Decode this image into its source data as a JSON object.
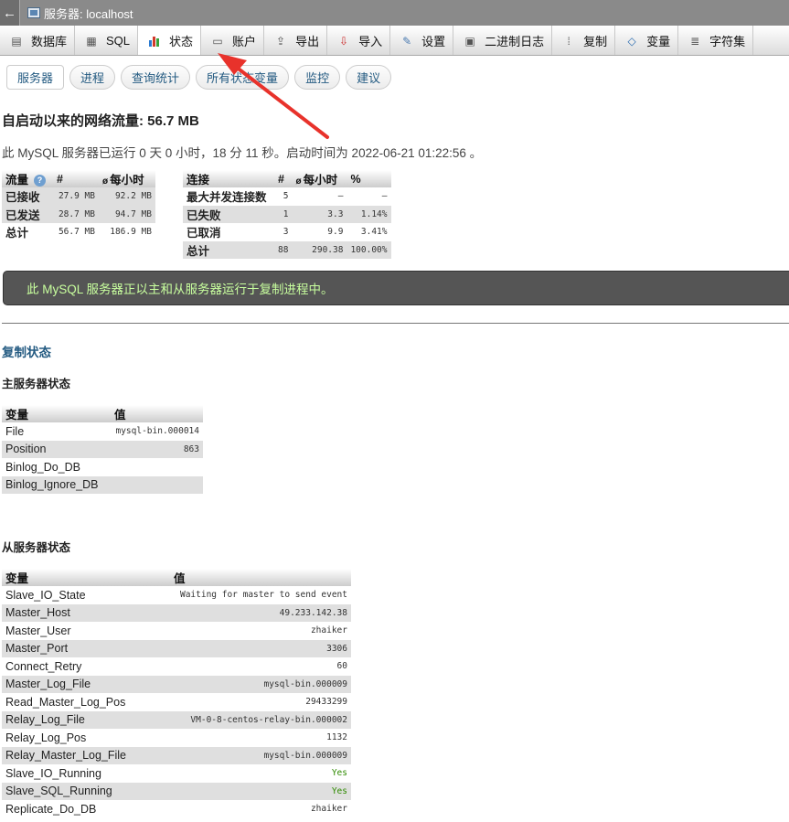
{
  "window": {
    "title": "服务器: localhost",
    "back_glyph": "←"
  },
  "menu": [
    {
      "label": "数据库",
      "icon": "database-icon",
      "glyph": "▤"
    },
    {
      "label": "SQL",
      "icon": "sql-icon",
      "glyph": "▦"
    },
    {
      "label": "状态",
      "icon": "status-chart-icon",
      "glyph": "▮"
    },
    {
      "label": "账户",
      "icon": "accounts-icon",
      "glyph": "▭"
    },
    {
      "label": "导出",
      "icon": "export-icon",
      "glyph": "⇪"
    },
    {
      "label": "导入",
      "icon": "import-icon",
      "glyph": "⇩"
    },
    {
      "label": "设置",
      "icon": "wrench-icon",
      "glyph": "✎"
    },
    {
      "label": "二进制日志",
      "icon": "binlog-icon",
      "glyph": "▣"
    },
    {
      "label": "复制",
      "icon": "replication-icon",
      "glyph": "⁞"
    },
    {
      "label": "变量",
      "icon": "variables-icon",
      "glyph": "◇"
    },
    {
      "label": "字符集",
      "icon": "charset-icon",
      "glyph": "≣"
    }
  ],
  "subtabs": [
    "服务器",
    "进程",
    "查询统计",
    "所有状态变量",
    "监控",
    "建议"
  ],
  "heading": "自启动以来的网络流量: 56.7 MB",
  "uptime": "此 MySQL 服务器已运行 0 天 0 小时，18 分 11 秒。启动时间为 2022-06-21 01:22:56 。",
  "traffic": {
    "headers": [
      "流量",
      "#",
      "每小时"
    ],
    "rows": [
      [
        "已接收",
        "27.9 MB",
        "92.2 MB"
      ],
      [
        "已发送",
        "28.7 MB",
        "94.7 MB"
      ],
      [
        "总计",
        "56.7 MB",
        "186.9 MB"
      ]
    ]
  },
  "connections": {
    "headers": [
      "连接",
      "#",
      "每小时",
      "%"
    ],
    "rows": [
      [
        "最大并发连接数",
        "5",
        "—",
        "—"
      ],
      [
        "已失败",
        "1",
        "3.3",
        "1.14%"
      ],
      [
        "已取消",
        "3",
        "9.9",
        "3.41%"
      ],
      [
        "总计",
        "88",
        "290.38",
        "100.00%"
      ]
    ]
  },
  "notice": "此 MySQL 服务器正以主和从服务器运行于复制进程中。",
  "replication": {
    "title": "复制状态",
    "master_title": "主服务器状态",
    "slave_title": "从服务器状态",
    "headers": [
      "变量",
      "值"
    ],
    "master": [
      [
        "File",
        "mysql-bin.000014"
      ],
      [
        "Position",
        "863"
      ],
      [
        "Binlog_Do_DB",
        ""
      ],
      [
        "Binlog_Ignore_DB",
        ""
      ]
    ],
    "slave": [
      [
        "Slave_IO_State",
        "Waiting for master to send event"
      ],
      [
        "Master_Host",
        "49.233.142.38"
      ],
      [
        "Master_User",
        "zhaiker"
      ],
      [
        "Master_Port",
        "3306"
      ],
      [
        "Connect_Retry",
        "60"
      ],
      [
        "Master_Log_File",
        "mysql-bin.000009"
      ],
      [
        "Read_Master_Log_Pos",
        "29433299"
      ],
      [
        "Relay_Log_File",
        "VM-0-8-centos-relay-bin.000002"
      ],
      [
        "Relay_Log_Pos",
        "1132"
      ],
      [
        "Relay_Master_Log_File",
        "mysql-bin.000009"
      ],
      [
        "Slave_IO_Running",
        "Yes"
      ],
      [
        "Slave_SQL_Running",
        "Yes"
      ],
      [
        "Replicate_Do_DB",
        "zhaiker"
      ]
    ]
  },
  "colors": {
    "accent_link": "#235a81",
    "notice_text": "#c8ff9e",
    "yes": "#2f8a00",
    "arrow": "#e8322b"
  }
}
